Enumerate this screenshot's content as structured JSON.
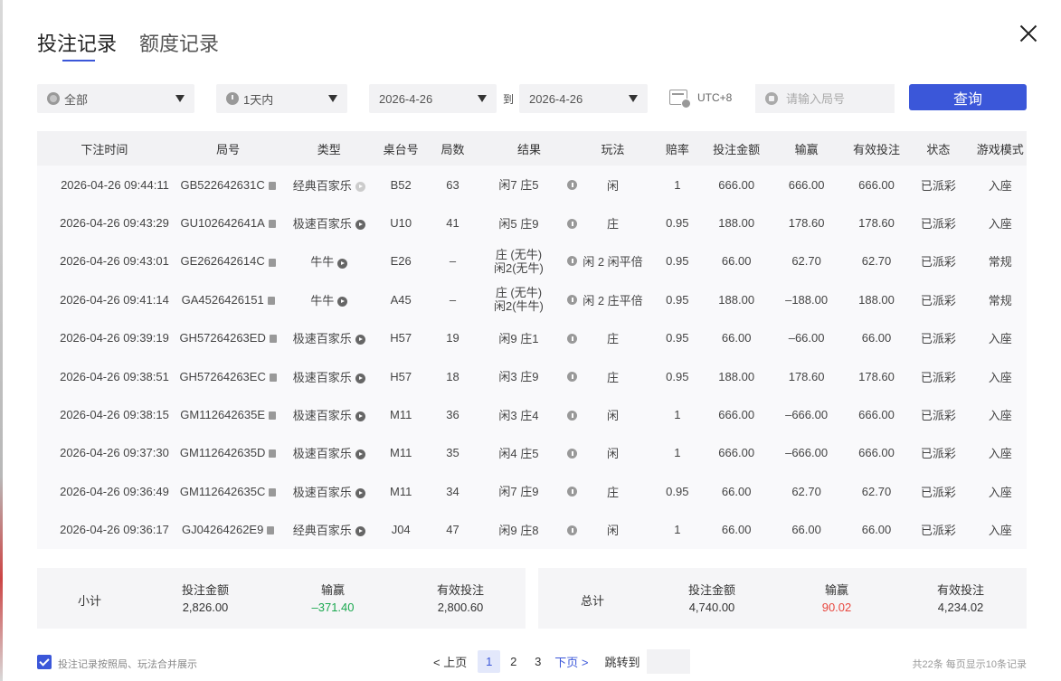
{
  "tabs": [
    "投注记录",
    "额度记录"
  ],
  "filters": {
    "game": "全部",
    "period": "1天内",
    "date_from": "2026-4-26",
    "to_label": "到",
    "date_to": "2026-4-26",
    "timezone": "UTC+8",
    "round_placeholder": "请输入局号",
    "query_label": "查询"
  },
  "table": {
    "headers": [
      "下注时间",
      "局号",
      "类型",
      "桌台号",
      "局数",
      "结果",
      "玩法",
      "赔率",
      "投注金额",
      "输赢",
      "有效投注",
      "状态",
      "游戏模式"
    ],
    "rows": [
      {
        "time": "2026-04-26 09:44:11",
        "round": "GB522642631C",
        "type": "经典百家乐",
        "table": "B52",
        "shoe": "63",
        "result1": "闲7 庄5",
        "result2": "",
        "bet": "闲",
        "odds": "1",
        "amount": "666.00",
        "win": "666.00",
        "win_sign": "pos",
        "valid": "666.00",
        "status": "已派彩",
        "mode": "入座",
        "play_light": true
      },
      {
        "time": "2026-04-26 09:43:29",
        "round": "GU102642641A",
        "type": "极速百家乐",
        "table": "U10",
        "shoe": "41",
        "result1": "闲5 庄9",
        "result2": "",
        "bet": "庄",
        "odds": "0.95",
        "amount": "188.00",
        "win": "178.60",
        "win_sign": "pos",
        "valid": "178.60",
        "status": "已派彩",
        "mode": "入座",
        "play_light": false
      },
      {
        "time": "2026-04-26 09:43:01",
        "round": "GE262642614C",
        "type": "牛牛",
        "table": "E26",
        "shoe": "–",
        "result1": "庄 (无牛)",
        "result2": "闲2(无牛)",
        "bet": "闲 2 闲平倍",
        "odds": "0.95",
        "amount": "66.00",
        "win": "62.70",
        "win_sign": "pos",
        "valid": "62.70",
        "status": "已派彩",
        "mode": "常规",
        "play_light": false
      },
      {
        "time": "2026-04-26 09:41:14",
        "round": "GA4526426151",
        "type": "牛牛",
        "table": "A45",
        "shoe": "–",
        "result1": "庄 (无牛)",
        "result2": "闲2(牛牛)",
        "bet": "闲 2 庄平倍",
        "odds": "0.95",
        "amount": "188.00",
        "win": "–188.00",
        "win_sign": "neg",
        "valid": "188.00",
        "status": "已派彩",
        "mode": "常规",
        "play_light": false
      },
      {
        "time": "2026-04-26 09:39:19",
        "round": "GH57264263ED",
        "type": "极速百家乐",
        "table": "H57",
        "shoe": "19",
        "result1": "闲9 庄1",
        "result2": "",
        "bet": "庄",
        "odds": "0.95",
        "amount": "66.00",
        "win": "–66.00",
        "win_sign": "neg",
        "valid": "66.00",
        "status": "已派彩",
        "mode": "入座",
        "play_light": false
      },
      {
        "time": "2026-04-26 09:38:51",
        "round": "GH57264263EC",
        "type": "极速百家乐",
        "table": "H57",
        "shoe": "18",
        "result1": "闲3 庄9",
        "result2": "",
        "bet": "庄",
        "odds": "0.95",
        "amount": "188.00",
        "win": "178.60",
        "win_sign": "pos",
        "valid": "178.60",
        "status": "已派彩",
        "mode": "入座",
        "play_light": false
      },
      {
        "time": "2026-04-26 09:38:15",
        "round": "GM112642635E",
        "type": "极速百家乐",
        "table": "M11",
        "shoe": "36",
        "result1": "闲3 庄4",
        "result2": "",
        "bet": "闲",
        "odds": "1",
        "amount": "666.00",
        "win": "–666.00",
        "win_sign": "neg",
        "valid": "666.00",
        "status": "已派彩",
        "mode": "入座",
        "play_light": false
      },
      {
        "time": "2026-04-26 09:37:30",
        "round": "GM112642635D",
        "type": "极速百家乐",
        "table": "M11",
        "shoe": "35",
        "result1": "闲4 庄5",
        "result2": "",
        "bet": "闲",
        "odds": "1",
        "amount": "666.00",
        "win": "–666.00",
        "win_sign": "neg",
        "valid": "666.00",
        "status": "已派彩",
        "mode": "入座",
        "play_light": false
      },
      {
        "time": "2026-04-26 09:36:49",
        "round": "GM112642635C",
        "type": "极速百家乐",
        "table": "M11",
        "shoe": "34",
        "result1": "闲7 庄9",
        "result2": "",
        "bet": "庄",
        "odds": "0.95",
        "amount": "66.00",
        "win": "62.70",
        "win_sign": "pos",
        "valid": "62.70",
        "status": "已派彩",
        "mode": "入座",
        "play_light": false
      },
      {
        "time": "2026-04-26 09:36:17",
        "round": "GJ04264262E9",
        "type": "经典百家乐",
        "table": "J04",
        "shoe": "47",
        "result1": "闲9 庄8",
        "result2": "",
        "bet": "闲",
        "odds": "1",
        "amount": "66.00",
        "win": "66.00",
        "win_sign": "pos",
        "valid": "66.00",
        "status": "已派彩",
        "mode": "入座",
        "play_light": false
      }
    ]
  },
  "subtotal": {
    "label": "小计",
    "amount_label": "投注金额",
    "amount": "2,826.00",
    "win_label": "输赢",
    "win": "–371.40",
    "valid_label": "有效投注",
    "valid": "2,800.60"
  },
  "grand_total": {
    "label": "总计",
    "amount_label": "投注金额",
    "amount": "4,740.00",
    "win_label": "输赢",
    "win": "90.02",
    "valid_label": "有效投注",
    "valid": "4,234.02"
  },
  "footer": {
    "merge_label": "投注记录按照局、玩法合并展示",
    "prev": "< 上页",
    "pages": [
      "1",
      "2",
      "3"
    ],
    "current_page": "1",
    "next": "下页 >",
    "jump_label": "跳转到",
    "total": "共22条   每页显示10条记录"
  },
  "colors": {
    "accent": "#3b57d9",
    "win": "#e8473f",
    "loss": "#1aa84f"
  }
}
